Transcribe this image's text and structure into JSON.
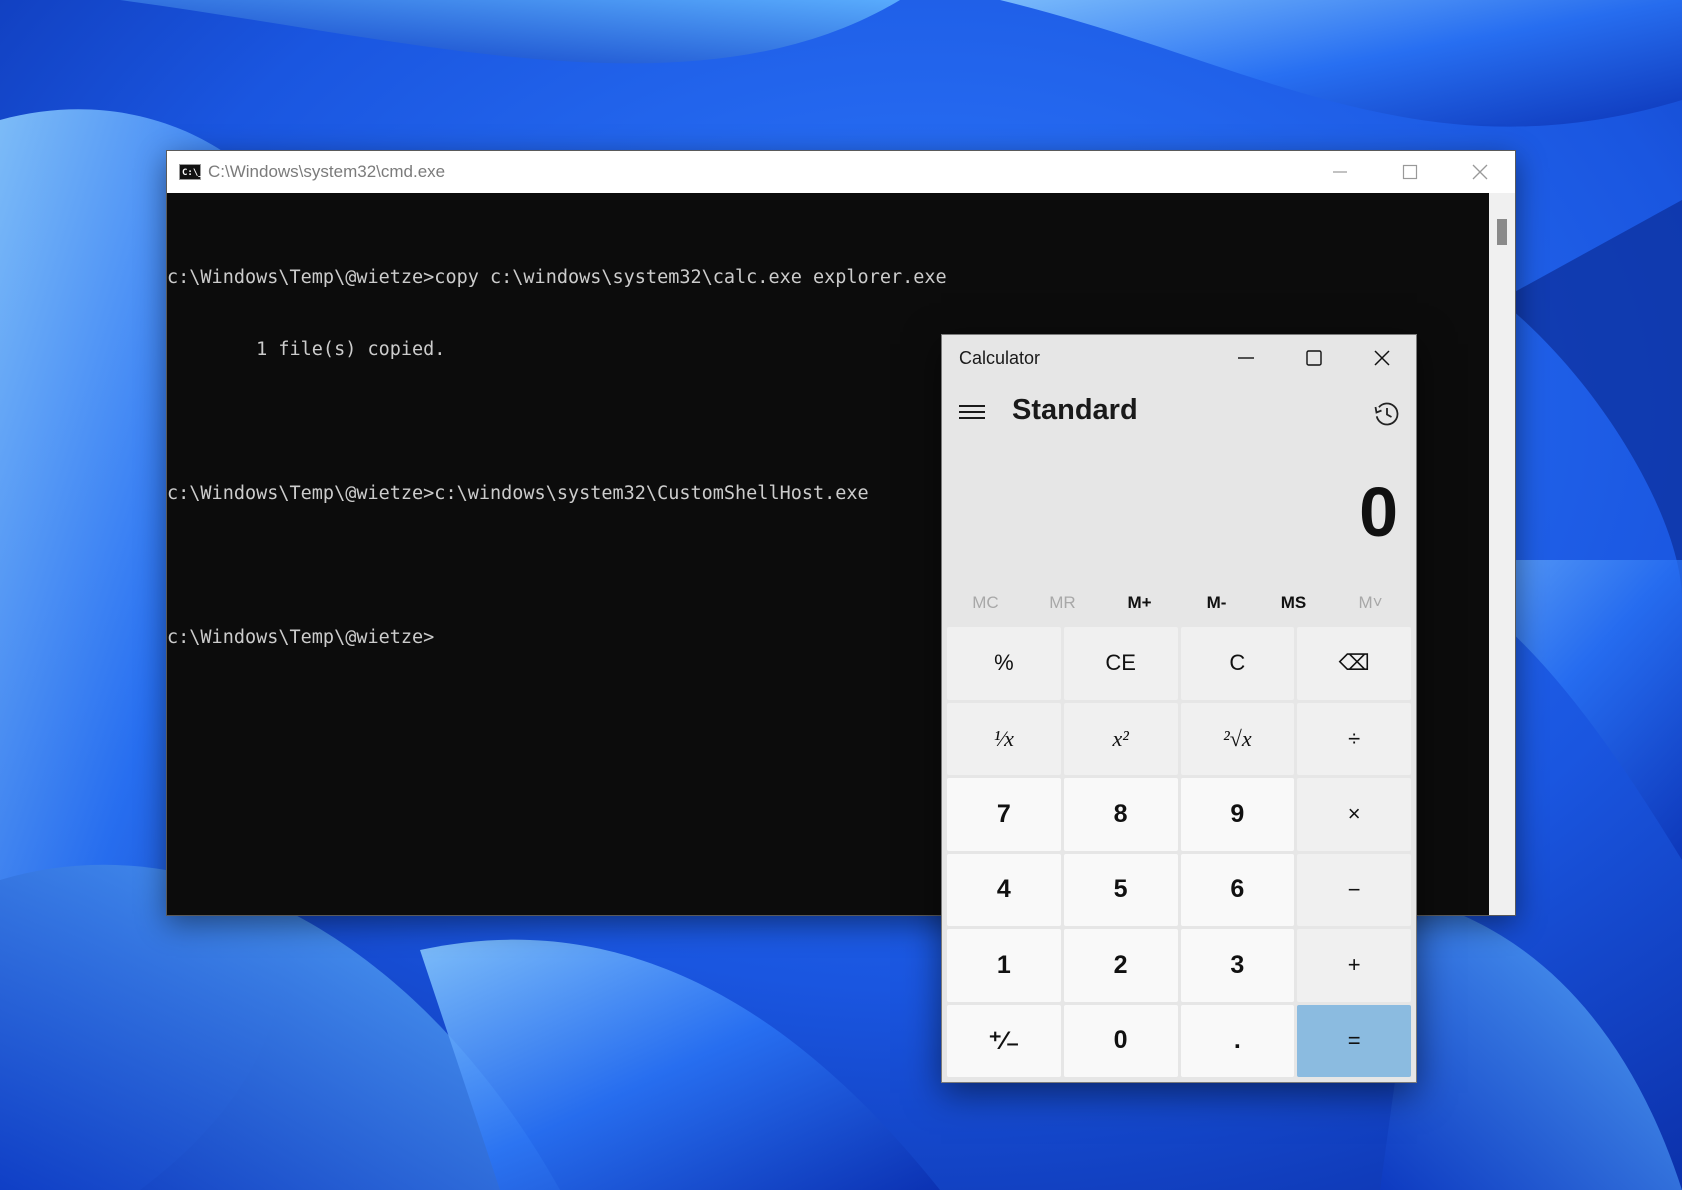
{
  "cmd": {
    "title": "C:\\Windows\\system32\\cmd.exe",
    "icon_text": "C:\\_",
    "lines": [
      "c:\\Windows\\Temp\\@wietze>copy c:\\windows\\system32\\calc.exe explorer.exe",
      "        1 file(s) copied.",
      "",
      "c:\\Windows\\Temp\\@wietze>c:\\windows\\system32\\CustomShellHost.exe",
      "",
      "c:\\Windows\\Temp\\@wietze>"
    ]
  },
  "calculator": {
    "title": "Calculator",
    "mode": "Standard",
    "display": "0",
    "memory": [
      {
        "label": "MC",
        "enabled": false
      },
      {
        "label": "MR",
        "enabled": false
      },
      {
        "label": "M+",
        "enabled": true
      },
      {
        "label": "M-",
        "enabled": true
      },
      {
        "label": "MS",
        "enabled": true
      },
      {
        "label": "M˅",
        "enabled": false
      }
    ],
    "keys": [
      {
        "label": "%",
        "name": "percent-button",
        "kind": "op"
      },
      {
        "label": "CE",
        "name": "clear-entry-button",
        "kind": "op"
      },
      {
        "label": "C",
        "name": "clear-button",
        "kind": "op"
      },
      {
        "label": "⌫",
        "name": "backspace-button",
        "kind": "op"
      },
      {
        "label": "¹⁄x",
        "name": "reciprocal-button",
        "kind": "fn"
      },
      {
        "label": "x²",
        "name": "square-button",
        "kind": "fn"
      },
      {
        "label": "²√x",
        "name": "square-root-button",
        "kind": "fn"
      },
      {
        "label": "÷",
        "name": "divide-button",
        "kind": "op"
      },
      {
        "label": "7",
        "name": "digit-7-button",
        "kind": "num"
      },
      {
        "label": "8",
        "name": "digit-8-button",
        "kind": "num"
      },
      {
        "label": "9",
        "name": "digit-9-button",
        "kind": "num"
      },
      {
        "label": "×",
        "name": "multiply-button",
        "kind": "op"
      },
      {
        "label": "4",
        "name": "digit-4-button",
        "kind": "num"
      },
      {
        "label": "5",
        "name": "digit-5-button",
        "kind": "num"
      },
      {
        "label": "6",
        "name": "digit-6-button",
        "kind": "num"
      },
      {
        "label": "−",
        "name": "subtract-button",
        "kind": "op"
      },
      {
        "label": "1",
        "name": "digit-1-button",
        "kind": "num"
      },
      {
        "label": "2",
        "name": "digit-2-button",
        "kind": "num"
      },
      {
        "label": "3",
        "name": "digit-3-button",
        "kind": "num"
      },
      {
        "label": "+",
        "name": "add-button",
        "kind": "op"
      },
      {
        "label": "⁺⁄₋",
        "name": "negate-button",
        "kind": "num"
      },
      {
        "label": "0",
        "name": "digit-0-button",
        "kind": "num"
      },
      {
        "label": ".",
        "name": "decimal-button",
        "kind": "num"
      },
      {
        "label": "=",
        "name": "equals-button",
        "kind": "eq"
      }
    ]
  },
  "colors": {
    "accent_equals": "#8bbbe0",
    "cmd_background": "#0c0c0c",
    "cmd_text": "#cccccc"
  }
}
